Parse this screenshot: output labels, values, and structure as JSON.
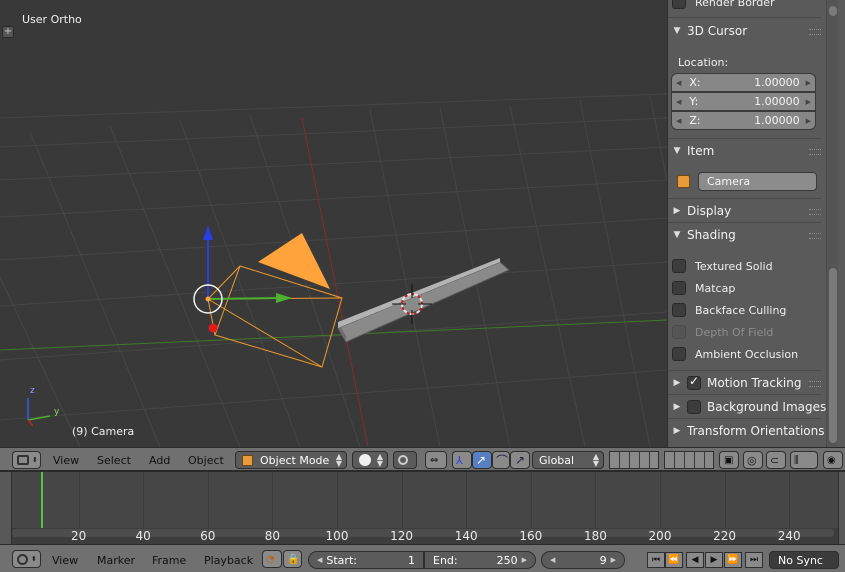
{
  "viewport": {
    "view_name": "User Ortho",
    "object_label": "(9) Camera",
    "axis_x": "y",
    "axis_z": "z"
  },
  "properties": {
    "render_border_label": "Render Border",
    "cursor_panel": {
      "title": "3D Cursor",
      "location_label": "Location:",
      "x_label": "X:",
      "x_value": "1.00000",
      "y_label": "Y:",
      "y_value": "1.00000",
      "z_label": "Z:",
      "z_value": "1.00000"
    },
    "item_panel": {
      "title": "Item",
      "name": "Camera"
    },
    "display_panel": {
      "title": "Display"
    },
    "shading_panel": {
      "title": "Shading",
      "textured_solid": "Textured Solid",
      "matcap": "Matcap",
      "backface_culling": "Backface Culling",
      "depth_of_field": "Depth Of Field",
      "ambient_occlusion": "Ambient Occlusion"
    },
    "motion_tracking": "Motion Tracking",
    "background_images": "Background Images",
    "transform_orientations": "Transform Orientations"
  },
  "header": {
    "view": "View",
    "select": "Select",
    "add": "Add",
    "object": "Object",
    "mode": "Object Mode",
    "orientation": "Global"
  },
  "timeline": {
    "ticks": [
      "20",
      "40",
      "60",
      "80",
      "100",
      "120",
      "140",
      "160",
      "180",
      "200",
      "220",
      "240"
    ],
    "current_frame": 9
  },
  "timeline_header": {
    "view": "View",
    "marker": "Marker",
    "frame": "Frame",
    "playback": "Playback",
    "start_label": "Start:",
    "start_value": "1",
    "end_label": "End:",
    "end_value": "250",
    "current_value": "9",
    "sync": "No Sync"
  },
  "colors": {
    "accent": "#ffa33a",
    "x_axis_red": "#b0302b",
    "y_axis_green": "#4eb02f",
    "blue_arrow": "#2a3ee8",
    "frame_indicator": "#55c144"
  }
}
